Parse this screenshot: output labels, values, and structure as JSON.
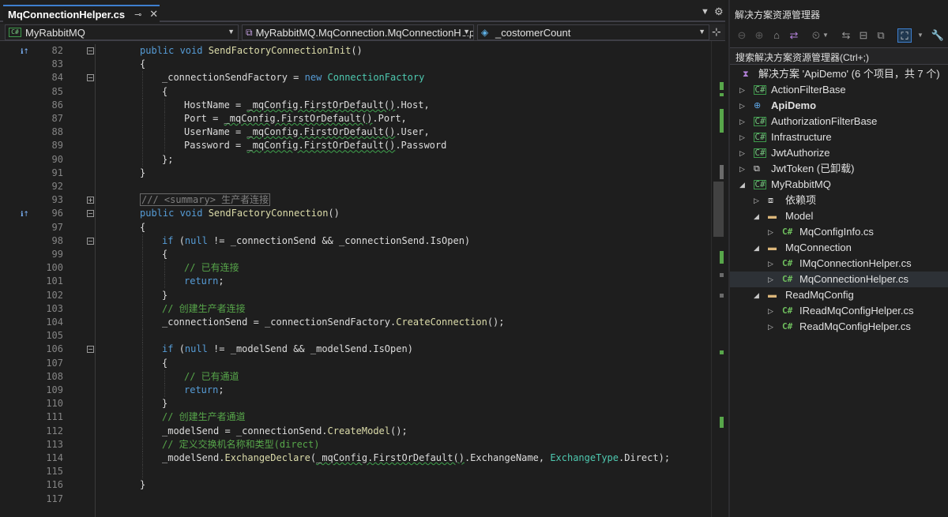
{
  "tab": {
    "title": "MqConnectionHelper.cs",
    "pin": "⊸",
    "close": "✕"
  },
  "nav": {
    "project": "MyRabbitMQ",
    "class": "MyRabbitMQ.MqConnection.MqConnectionHelper",
    "member": "_costomerCount"
  },
  "code_lines": [
    {
      "n": "82",
      "marker": "ℹ↑",
      "fold": "−",
      "tokens": [
        [
          "kw",
          "public "
        ],
        [
          "kw",
          "void "
        ],
        [
          "mt",
          "SendFactoryConnectionInit"
        ],
        [
          "",
          "()"
        ]
      ],
      "indent": 0
    },
    {
      "n": "83",
      "tokens": [
        [
          "",
          "{"
        ]
      ],
      "indent": 0
    },
    {
      "n": "84",
      "fold": "−",
      "tokens": [
        [
          "",
          "_connectionSendFactory = "
        ],
        [
          "kw",
          "new "
        ],
        [
          "ty",
          "ConnectionFactory"
        ]
      ],
      "indent": 1
    },
    {
      "n": "85",
      "tokens": [
        [
          "",
          "{"
        ]
      ],
      "indent": 1
    },
    {
      "n": "86",
      "tokens": [
        [
          "",
          "HostName = "
        ],
        [
          "sq",
          "_mqConfig.FirstOrDefault()"
        ],
        [
          "",
          ".Host,"
        ]
      ],
      "indent": 2
    },
    {
      "n": "87",
      "tokens": [
        [
          "",
          "Port = "
        ],
        [
          "sq",
          "_mqConfig.FirstOrDefault()"
        ],
        [
          "",
          ".Port,"
        ]
      ],
      "indent": 2
    },
    {
      "n": "88",
      "tokens": [
        [
          "",
          "UserName = "
        ],
        [
          "sq",
          "_mqConfig.FirstOrDefault()"
        ],
        [
          "",
          ".User,"
        ]
      ],
      "indent": 2
    },
    {
      "n": "89",
      "tokens": [
        [
          "",
          "Password = "
        ],
        [
          "sq",
          "_mqConfig.FirstOrDefault()"
        ],
        [
          "",
          ".Password"
        ]
      ],
      "indent": 2
    },
    {
      "n": "90",
      "tokens": [
        [
          "",
          "};"
        ]
      ],
      "indent": 1
    },
    {
      "n": "91",
      "tokens": [
        [
          "",
          "}"
        ]
      ],
      "indent": 0
    },
    {
      "n": "92",
      "tokens": [],
      "indent": 0
    },
    {
      "n": "93",
      "fold": "+",
      "tokens": [
        [
          "collapsed",
          "/// <summary> 生产者连接"
        ]
      ],
      "indent": 0
    },
    {
      "n": "96",
      "marker": "ℹ↑",
      "fold": "−",
      "tokens": [
        [
          "kw",
          "public "
        ],
        [
          "kw",
          "void "
        ],
        [
          "mt",
          "SendFactoryConnection"
        ],
        [
          "",
          "()"
        ]
      ],
      "indent": 0
    },
    {
      "n": "97",
      "tokens": [
        [
          "",
          "{"
        ]
      ],
      "indent": 0
    },
    {
      "n": "98",
      "fold": "−",
      "tokens": [
        [
          "kw",
          "if "
        ],
        [
          "",
          "("
        ],
        [
          "kw",
          "null"
        ],
        [
          "",
          " != _connectionSend && _connectionSend.IsOpen)"
        ]
      ],
      "indent": 1
    },
    {
      "n": "99",
      "tokens": [
        [
          "",
          "{"
        ]
      ],
      "indent": 1
    },
    {
      "n": "100",
      "tokens": [
        [
          "cm",
          "// 已有连接"
        ]
      ],
      "indent": 2
    },
    {
      "n": "101",
      "tokens": [
        [
          "kw",
          "return"
        ],
        [
          "",
          ";"
        ]
      ],
      "indent": 2
    },
    {
      "n": "102",
      "tokens": [
        [
          "",
          "}"
        ]
      ],
      "indent": 1
    },
    {
      "n": "103",
      "tokens": [
        [
          "cm",
          "// 创建生产者连接"
        ]
      ],
      "indent": 1
    },
    {
      "n": "104",
      "tokens": [
        [
          "",
          "_connectionSend = _connectionSendFactory."
        ],
        [
          "mt",
          "CreateConnection"
        ],
        [
          "",
          "();"
        ]
      ],
      "indent": 1
    },
    {
      "n": "105",
      "tokens": [],
      "indent": 1
    },
    {
      "n": "106",
      "fold": "−",
      "tokens": [
        [
          "kw",
          "if "
        ],
        [
          "",
          "("
        ],
        [
          "kw",
          "null"
        ],
        [
          "",
          " != _modelSend && _modelSend.IsOpen)"
        ]
      ],
      "indent": 1
    },
    {
      "n": "107",
      "tokens": [
        [
          "",
          "{"
        ]
      ],
      "indent": 1
    },
    {
      "n": "108",
      "tokens": [
        [
          "cm",
          "// 已有通道"
        ]
      ],
      "indent": 2
    },
    {
      "n": "109",
      "tokens": [
        [
          "kw",
          "return"
        ],
        [
          "",
          ";"
        ]
      ],
      "indent": 2
    },
    {
      "n": "110",
      "tokens": [
        [
          "",
          "}"
        ]
      ],
      "indent": 1
    },
    {
      "n": "111",
      "tokens": [
        [
          "cm",
          "// 创建生产者通道"
        ]
      ],
      "indent": 1
    },
    {
      "n": "112",
      "tokens": [
        [
          "",
          "_modelSend = _connectionSend."
        ],
        [
          "mt",
          "CreateModel"
        ],
        [
          "",
          "();"
        ]
      ],
      "indent": 1
    },
    {
      "n": "113",
      "tokens": [
        [
          "cm",
          "// 定义交换机名称和类型(direct)"
        ]
      ],
      "indent": 1
    },
    {
      "n": "114",
      "tokens": [
        [
          "",
          "_modelSend."
        ],
        [
          "mt",
          "ExchangeDeclare"
        ],
        [
          "",
          "("
        ],
        [
          "sq",
          "_mqConfig.FirstOrDefault()"
        ],
        [
          "",
          ".ExchangeName, "
        ],
        [
          "ty",
          "ExchangeType"
        ],
        [
          "",
          ".Direct);"
        ]
      ],
      "indent": 1
    },
    {
      "n": "115",
      "tokens": [],
      "indent": 1
    },
    {
      "n": "116",
      "tokens": [
        [
          "",
          "}"
        ]
      ],
      "indent": 0
    },
    {
      "n": "117",
      "tokens": [],
      "indent": 0
    }
  ],
  "solution_explorer": {
    "title": "解决方案资源管理器",
    "search_placeholder": "搜索解决方案资源管理器(Ctrl+;)",
    "tree": [
      {
        "label": "解决方案 'ApiDemo' (6 个项目，共 7 个)",
        "icon": "solution",
        "level": 0,
        "expander": ""
      },
      {
        "label": "ActionFilterBase",
        "icon": "project",
        "level": 1,
        "expander": "▷"
      },
      {
        "label": "ApiDemo",
        "icon": "web",
        "level": 1,
        "expander": "▷",
        "bold": true
      },
      {
        "label": "AuthorizationFilterBase",
        "icon": "project",
        "level": 1,
        "expander": "▷"
      },
      {
        "label": "Infrastructure",
        "icon": "project",
        "level": 1,
        "expander": "▷"
      },
      {
        "label": "JwtAuthorize",
        "icon": "project",
        "level": 1,
        "expander": "▷"
      },
      {
        "label": "JwtToken (已卸载)",
        "icon": "unloaded",
        "level": 1,
        "expander": "▷"
      },
      {
        "label": "MyRabbitMQ",
        "icon": "project",
        "level": 1,
        "expander": "◢"
      },
      {
        "label": "依赖项",
        "icon": "deps",
        "level": 2,
        "expander": "▷"
      },
      {
        "label": "Model",
        "icon": "folder",
        "level": 2,
        "expander": "◢"
      },
      {
        "label": "MqConfigInfo.cs",
        "icon": "cs",
        "level": 3,
        "expander": "▷"
      },
      {
        "label": "MqConnection",
        "icon": "folder",
        "level": 2,
        "expander": "◢"
      },
      {
        "label": "IMqConnectionHelper.cs",
        "icon": "cs",
        "level": 3,
        "expander": "▷"
      },
      {
        "label": "MqConnectionHelper.cs",
        "icon": "cs",
        "level": 3,
        "expander": "▷",
        "selected": true
      },
      {
        "label": "ReadMqConfig",
        "icon": "folder",
        "level": 2,
        "expander": "◢"
      },
      {
        "label": "IReadMqConfigHelper.cs",
        "icon": "cs",
        "level": 3,
        "expander": "▷"
      },
      {
        "label": "ReadMqConfigHelper.cs",
        "icon": "cs",
        "level": 3,
        "expander": "▷"
      }
    ]
  }
}
